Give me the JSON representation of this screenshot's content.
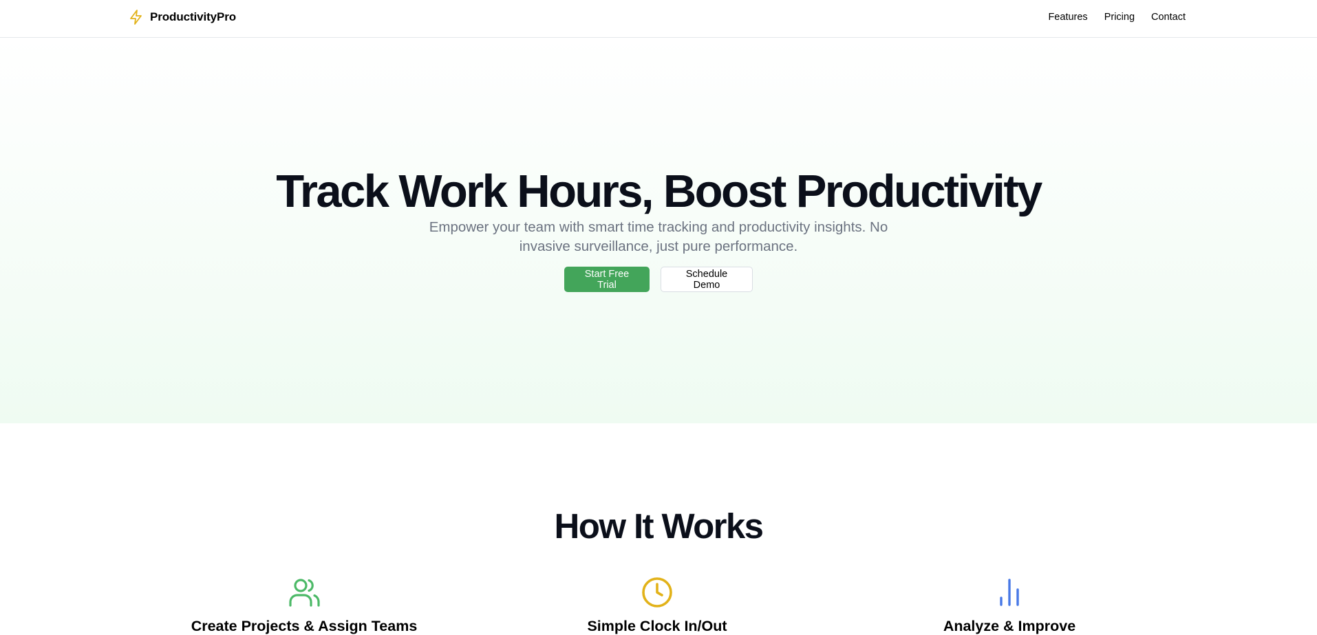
{
  "nav": {
    "brand": "ProductivityPro",
    "links": [
      "Features",
      "Pricing",
      "Contact"
    ]
  },
  "hero": {
    "title": "Track Work Hours, Boost Productivity",
    "subtitle": "Empower your team with smart time tracking and productivity insights. No invasive surveillance, just pure performance.",
    "primary_cta": "Start Free Trial",
    "secondary_cta": "Schedule Demo"
  },
  "how_it_works": {
    "title": "How It Works",
    "steps": [
      {
        "title": "Create Projects & Assign Teams",
        "icon": "users-icon",
        "color": "#4cb967"
      },
      {
        "title": "Simple Clock In/Out",
        "icon": "clock-icon",
        "color": "#e2b219"
      },
      {
        "title": "Analyze & Improve",
        "icon": "bar-chart-icon",
        "color": "#4778e6"
      }
    ]
  },
  "colors": {
    "brand_icon": "#e2b219",
    "primary": "#43a55a",
    "hero_gradient_end": "#effbf2"
  }
}
